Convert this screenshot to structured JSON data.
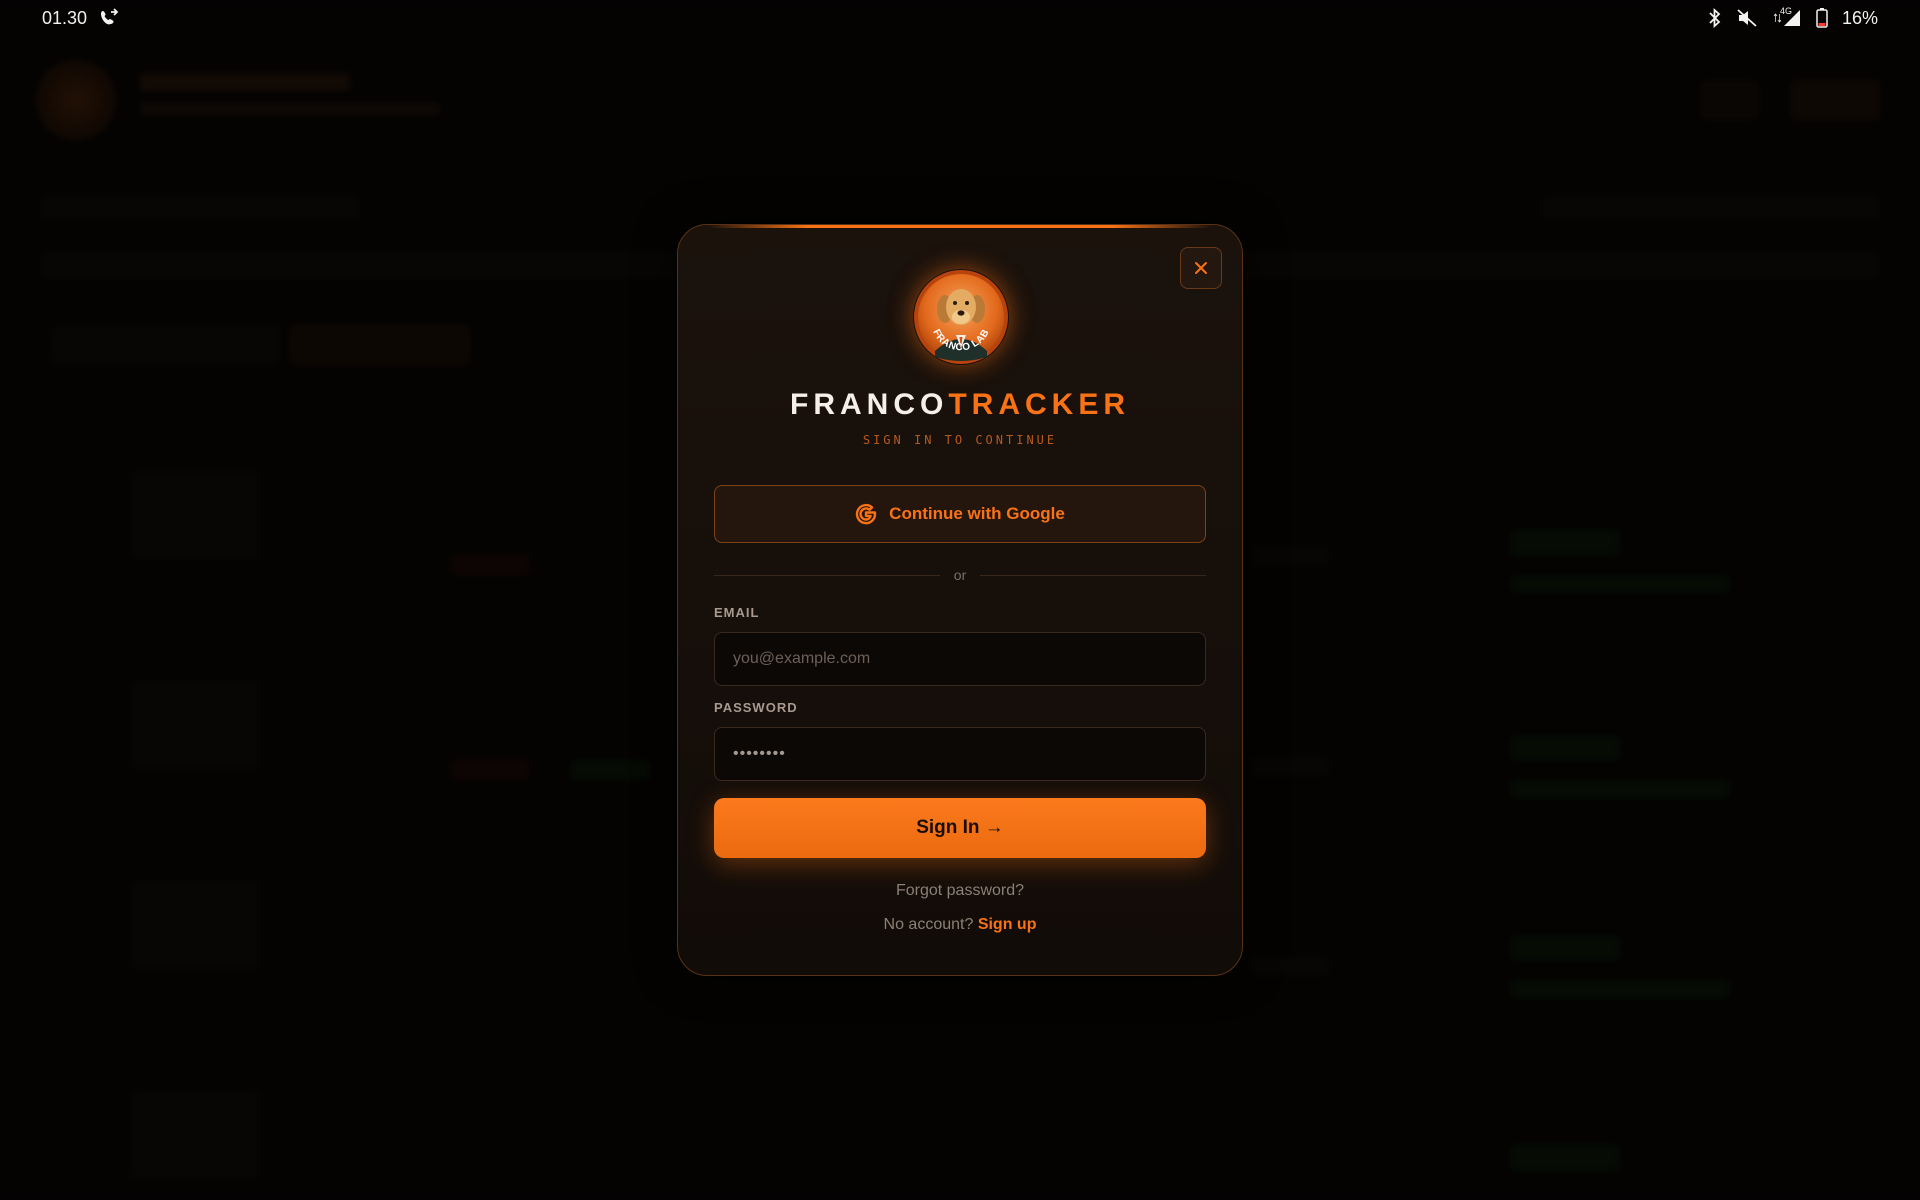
{
  "status_bar": {
    "time": "01.30",
    "battery": "16%",
    "network": "4G"
  },
  "modal": {
    "brand_primary": "FRANCO",
    "brand_accent": "TRACKER",
    "logo_text": "FRANCO LAB",
    "subtitle": "SIGN IN TO CONTINUE",
    "google_label": "Continue with Google",
    "divider": "or",
    "email_label": "EMAIL",
    "email_placeholder": "you@example.com",
    "password_label": "PASSWORD",
    "password_value": "••••••••",
    "signin_label": "Sign In →",
    "forgot_label": "Forgot password?",
    "signup_prompt": "No account?",
    "signup_link": "Sign up"
  },
  "colors": {
    "accent": "#f97316",
    "background": "#0b0806",
    "modal_bg": "#1b120c",
    "border": "#5a3115"
  },
  "icons": [
    "call-forward-icon",
    "bluetooth-icon",
    "mute-icon",
    "signal-icon",
    "battery-icon",
    "close-icon",
    "google-icon",
    "dog-logo-icon"
  ]
}
